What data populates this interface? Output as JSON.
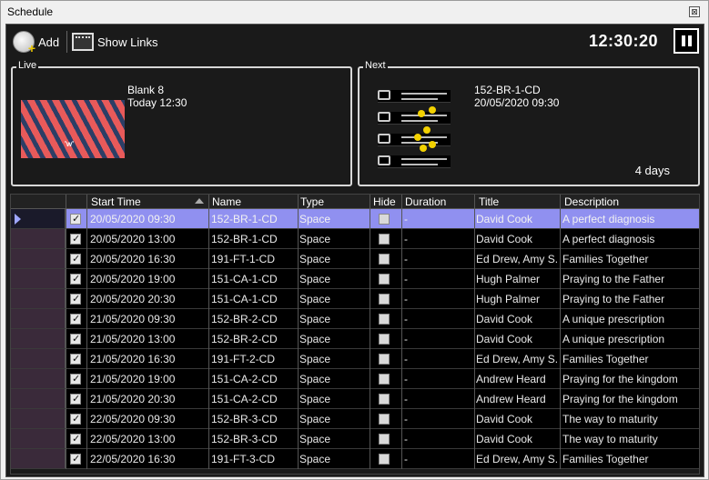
{
  "window": {
    "title": "Schedule",
    "close_label": "⊠"
  },
  "toolbar": {
    "add_label": "Add",
    "show_links_label": "Show Links",
    "clock": "12:30:20"
  },
  "live": {
    "label": "Live",
    "name": "Blank 8",
    "time": "Today 12:30",
    "watermark": "'w'"
  },
  "next": {
    "label": "Next",
    "name": "152-BR-1-CD",
    "time": "20/05/2020 09:30",
    "countdown": "4 days"
  },
  "grid": {
    "columns": [
      "Start Time",
      "Name",
      "Type",
      "Hide",
      "Duration",
      "Title",
      "Description"
    ],
    "rows": [
      {
        "start": "20/05/2020 09:30",
        "name": "152-BR-1-CD",
        "type": "Space",
        "duration": "-",
        "title": "David Cook",
        "desc": "A perfect diagnosis",
        "selected": true
      },
      {
        "start": "20/05/2020 13:00",
        "name": "152-BR-1-CD",
        "type": "Space",
        "duration": "-",
        "title": "David Cook",
        "desc": "A perfect diagnosis"
      },
      {
        "start": "20/05/2020 16:30",
        "name": "191-FT-1-CD",
        "type": "Space",
        "duration": "-",
        "title": "Ed Drew, Amy S...",
        "desc": "Families Together"
      },
      {
        "start": "20/05/2020 19:00",
        "name": "151-CA-1-CD",
        "type": "Space",
        "duration": "-",
        "title": "Hugh Palmer",
        "desc": "Praying to the Father"
      },
      {
        "start": "20/05/2020 20:30",
        "name": "151-CA-1-CD",
        "type": "Space",
        "duration": "-",
        "title": "Hugh Palmer",
        "desc": "Praying to the Father"
      },
      {
        "start": "21/05/2020 09:30",
        "name": "152-BR-2-CD",
        "type": "Space",
        "duration": "-",
        "title": "David Cook",
        "desc": "A unique prescription"
      },
      {
        "start": "21/05/2020 13:00",
        "name": "152-BR-2-CD",
        "type": "Space",
        "duration": "-",
        "title": "David Cook",
        "desc": "A unique prescription"
      },
      {
        "start": "21/05/2020 16:30",
        "name": "191-FT-2-CD",
        "type": "Space",
        "duration": "-",
        "title": "Ed Drew, Amy S...",
        "desc": "Families Together"
      },
      {
        "start": "21/05/2020 19:00",
        "name": "151-CA-2-CD",
        "type": "Space",
        "duration": "-",
        "title": "Andrew Heard",
        "desc": "Praying for the kingdom"
      },
      {
        "start": "21/05/2020 20:30",
        "name": "151-CA-2-CD",
        "type": "Space",
        "duration": "-",
        "title": "Andrew Heard",
        "desc": "Praying for the kingdom"
      },
      {
        "start": "22/05/2020 09:30",
        "name": "152-BR-3-CD",
        "type": "Space",
        "duration": "-",
        "title": "David Cook",
        "desc": "The way to maturity"
      },
      {
        "start": "22/05/2020 13:00",
        "name": "152-BR-3-CD",
        "type": "Space",
        "duration": "-",
        "title": "David Cook",
        "desc": "The way to maturity"
      },
      {
        "start": "22/05/2020 16:30",
        "name": "191-FT-3-CD",
        "type": "Space",
        "duration": "-",
        "title": "Ed Drew, Amy S...",
        "desc": "Families Together"
      }
    ]
  },
  "colors": {
    "background": "#1a1a1a",
    "selected_row": "#9090f0",
    "indicator": "#3a2a3a"
  }
}
